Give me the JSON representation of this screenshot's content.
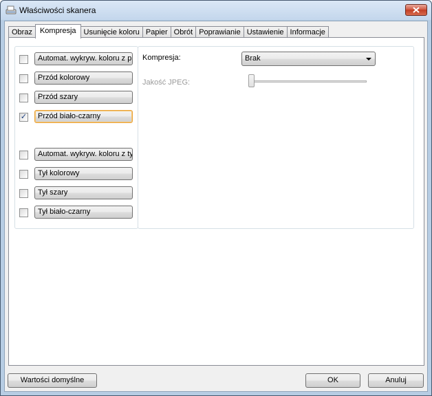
{
  "window": {
    "title": "Właściwości skanera",
    "icon": "scanner-icon",
    "close_icon": "close-icon"
  },
  "tabs": [
    {
      "label": "Obraz",
      "active": false
    },
    {
      "label": "Kompresja",
      "active": true
    },
    {
      "label": "Usunięcie koloru",
      "active": false
    },
    {
      "label": "Papier",
      "active": false
    },
    {
      "label": "Obrót",
      "active": false
    },
    {
      "label": "Poprawianie",
      "active": false
    },
    {
      "label": "Ustawienie",
      "active": false
    },
    {
      "label": "Informacje",
      "active": false
    }
  ],
  "image_types": {
    "front": [
      {
        "label": "Automat. wykryw. koloru z przo",
        "checked": false,
        "focused": false
      },
      {
        "label": "Przód kolorowy",
        "checked": false,
        "focused": false
      },
      {
        "label": "Przód szary",
        "checked": false,
        "focused": false
      },
      {
        "label": "Przód biało-czarny",
        "checked": true,
        "focused": true
      }
    ],
    "back": [
      {
        "label": "Automat. wykryw. koloru z tyłu",
        "checked": false,
        "focused": false
      },
      {
        "label": "Tył kolorowy",
        "checked": false,
        "focused": false
      },
      {
        "label": "Tył szary",
        "checked": false,
        "focused": false
      },
      {
        "label": "Tył biało-czarny",
        "checked": false,
        "focused": false
      }
    ]
  },
  "compression": {
    "label": "Kompresja:",
    "value": "Brak",
    "jpeg_quality_label": "Jakość JPEG:",
    "jpeg_quality_enabled": false,
    "jpeg_quality_level": 0
  },
  "footer": {
    "defaults_button": "Wartości domyślne",
    "ok_button": "OK",
    "cancel_button": "Anuluj"
  },
  "colors": {
    "accent_focus": "#e9a23b",
    "disabled_text": "#9a9a9a"
  }
}
